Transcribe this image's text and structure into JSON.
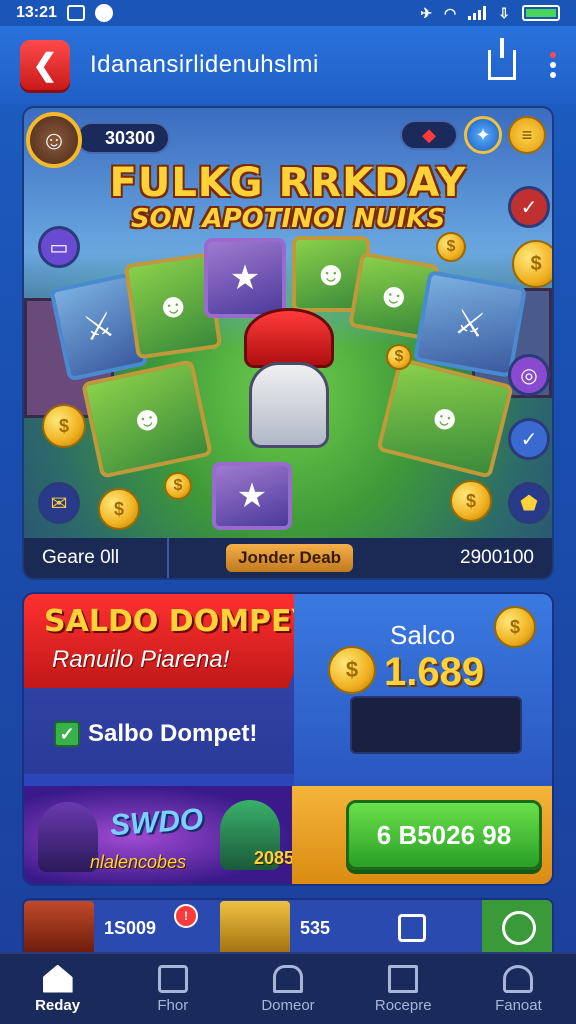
{
  "status_bar": {
    "time": "13:21"
  },
  "header": {
    "title": "Idanansirlidenuhslmi"
  },
  "hero": {
    "score": "30300",
    "title_line1": "FULKG RRKDAY",
    "title_line2": "SON APOTINOI NUIKS",
    "footer_left": "Geare 0ll",
    "footer_mid": "Jonder Deab",
    "footer_right": "2900100"
  },
  "saldo": {
    "ribbon_line1": "SALDO DOMPEY",
    "ribbon_line2": "Ranuilo Piarena!",
    "check_label": "Salbo Dompet!",
    "label": "Salco",
    "value": "1.689",
    "promo_title": "SWDO",
    "promo_sub": "nlalencobes",
    "promo_tag": "2085",
    "cta_label": "6 B5026 98"
  },
  "strip": {
    "item1_value": "1S009",
    "item2_value": "535"
  },
  "nav": {
    "items": [
      {
        "label": "Reday",
        "icon": "home-icon",
        "active": true
      },
      {
        "label": "Fhor",
        "icon": "camera-icon",
        "active": false
      },
      {
        "label": "Domeor",
        "icon": "house-icon",
        "active": false
      },
      {
        "label": "Rocepre",
        "icon": "map-icon",
        "active": false
      },
      {
        "label": "Fanoat",
        "icon": "user-icon",
        "active": false
      }
    ]
  },
  "colors": {
    "primary": "#1f5fc6",
    "accent_red": "#e02020",
    "accent_gold": "#ffd23a",
    "cta_green": "#3ab02a",
    "nav_bg": "#1a2a5a"
  }
}
